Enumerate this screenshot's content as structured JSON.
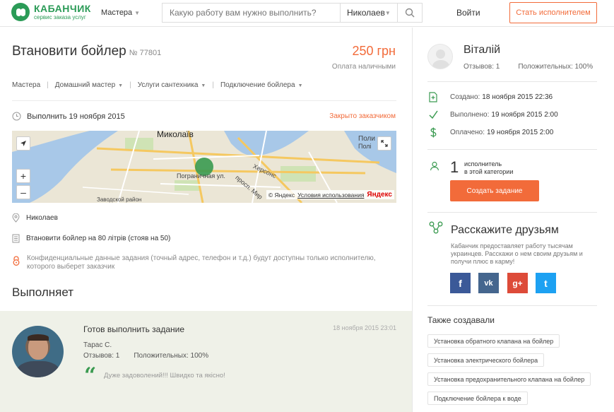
{
  "header": {
    "logo_name": "КАБАНЧИК",
    "logo_sub": "сервис заказа услуг",
    "nav_masters": "Мастера",
    "search_placeholder": "Какую работу вам нужно выполнить?",
    "city": "Николаев",
    "login": "Войти",
    "become_performer": "Стать исполнителем"
  },
  "task": {
    "title": "Втановити бойлер",
    "number": "№ 77801",
    "price": "250 грн",
    "payment": "Оплата наличными",
    "breadcrumbs": [
      {
        "label": "Мастера",
        "caret": false
      },
      {
        "label": "Домашний мастер",
        "caret": true
      },
      {
        "label": "Услуги сантехника",
        "caret": true
      },
      {
        "label": "Подключение бойлера",
        "caret": true
      }
    ],
    "execute_date": "Выполнить 19 ноября 2015",
    "status": "Закрыто заказчиком",
    "location": "Николаев",
    "description": "Втановити бойлер на 80 літрів (стояв на 50)",
    "confidential": "Конфиденциальные данные задания (точный адрес, телефон и т.д.) будут доступны только исполнителю, которого выберет заказчик"
  },
  "map": {
    "city_label": "Миколаїв",
    "street_label": "Пограничная ул.",
    "street2_label": "Херсонс",
    "street3_label": "просп. Мир",
    "corner_label": "Поли",
    "corner_label2": "Полі",
    "bottom_label": "Заводской район",
    "copyright": "© Яндекс",
    "terms": "Условия использования",
    "brand": "Яндекс",
    "zoom_in": "+",
    "zoom_out": "–"
  },
  "performer_section": {
    "heading": "Выполняет",
    "ready": "Готов выполнить задание",
    "date": "18 ноября 2015 23:01",
    "name": "Тарас С.",
    "reviews": "Отзывов: 1",
    "positive": "Положительных: 100%",
    "quote_mark": "“",
    "quote": "Дуже задоволений!!! Швидко та якісно!"
  },
  "customer": {
    "name": "Віталій",
    "reviews": "Отзывов: 1",
    "positive": "Положительных: 100%"
  },
  "timeline": {
    "created_label": "Создано:",
    "created_value": "18 ноября 2015 22:36",
    "done_label": "Выполнено:",
    "done_value": "19 ноября 2015 2:00",
    "paid_label": "Оплачено:",
    "paid_value": "19 ноября 2015 2:00"
  },
  "category": {
    "count": "1",
    "line1": "исполнитель",
    "line2": "в этой категории",
    "create_button": "Создать задание"
  },
  "share": {
    "heading": "Расскажите друзьям",
    "text": "Кабанчик предоставляет работу тысячам украинцев. Расскажи о нем своим друзьям и получи плюс в карму!",
    "facebook": "f",
    "vk": "vk",
    "google": "g+",
    "twitter": "t"
  },
  "also": {
    "heading": "Также создавали",
    "tags": [
      "Установка обратного клапана на бойлер",
      "Установка электрического бойлера",
      "Установка предохранительного клапана на бойлер",
      "Подключение бойлера к воде"
    ]
  },
  "colors": {
    "brand_green": "#2b9b57",
    "accent_orange": "#f26b3a",
    "facebook": "#3b5998",
    "vk": "#45668e",
    "google": "#dd4b39",
    "twitter": "#1da1f2"
  }
}
